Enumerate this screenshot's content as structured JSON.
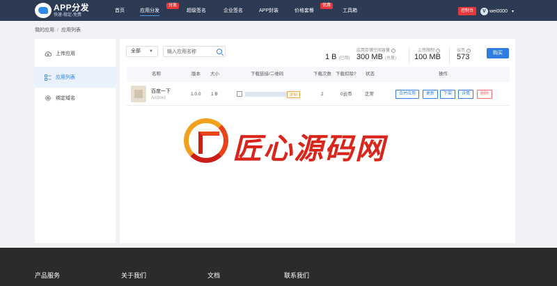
{
  "header": {
    "logo_title": "APP分发",
    "logo_sub": "快速-稳定-免费",
    "nav": [
      {
        "label": "首页"
      },
      {
        "label": "应用分发",
        "badge": "分发"
      },
      {
        "label": "超级签名"
      },
      {
        "label": "企业签名"
      },
      {
        "label": "APP封装"
      },
      {
        "label": "价格套餐",
        "badge": "优惠"
      },
      {
        "label": "工具箱"
      }
    ],
    "console_label": "控制台",
    "user_initial": "V",
    "username": "wei0000",
    "caret": "▾"
  },
  "breadcrumb": {
    "root": "我的应用",
    "separator": "/",
    "current": "应用列表"
  },
  "sidebar": {
    "items": [
      {
        "label": "上传应用",
        "icon": "cloud-upload-icon"
      },
      {
        "label": "应用列表",
        "icon": "list-icon",
        "active": true
      },
      {
        "label": "绑定域名",
        "icon": "gear-icon"
      }
    ]
  },
  "toolbar": {
    "filter_value": "全部",
    "search_placeholder": "输入应用名称"
  },
  "stats": {
    "storage_label": "应用存储空间容量",
    "used_value": "1 B",
    "used_suffix": "(已用)",
    "total_value": "300 MB",
    "total_suffix": "(总量)",
    "upload_label": "上传限制",
    "upload_value": "100 MB",
    "coins_label": "云币",
    "coins_value": "573",
    "help": "?",
    "buy_label": "购买"
  },
  "table": {
    "columns": [
      "名称",
      "版本",
      "大小",
      "下载链接/二维码",
      "下载次数",
      "下载扣除?",
      "状态",
      "操作"
    ],
    "rows": [
      {
        "name": "百度一下",
        "platform": "Android",
        "version": "1.0.0",
        "size": "1 B",
        "copy_label": "复制",
        "downloads": "2",
        "deduction": "0云币",
        "status": "正常",
        "actions": [
          "合并应用",
          "更新",
          "下架",
          "详情",
          "删除"
        ]
      }
    ]
  },
  "watermark": {
    "text": "匠心源码网"
  },
  "footer": {
    "items": [
      "产品服务",
      "关于我们",
      "文档",
      "联系我们"
    ]
  },
  "colors": {
    "nav_bg": "#2c3a54",
    "accent": "#2f7de1",
    "danger": "#e4393c",
    "footer_bg": "#2b2b2b"
  }
}
